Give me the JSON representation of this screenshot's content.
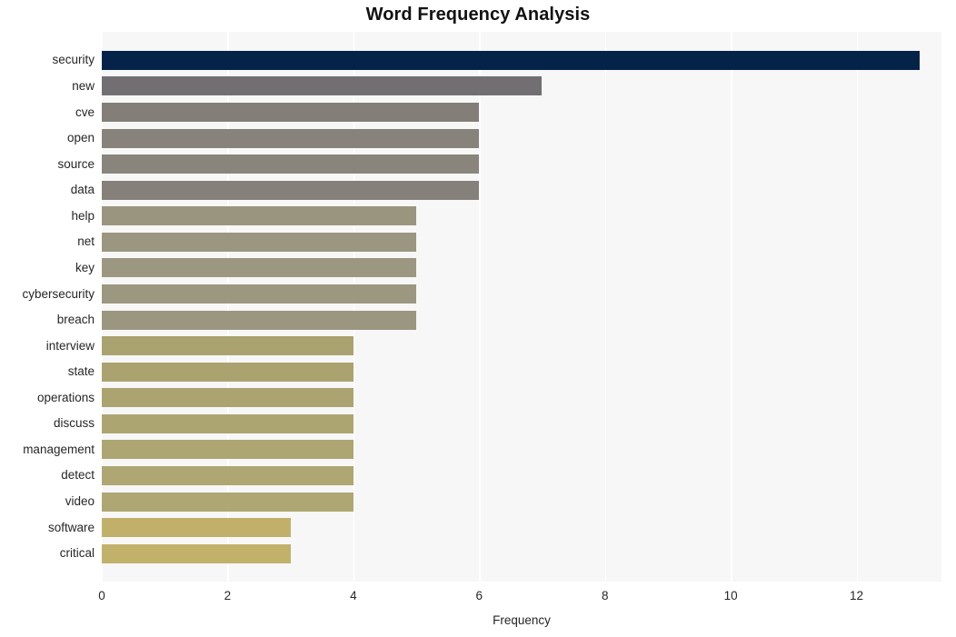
{
  "chart_data": {
    "type": "bar",
    "orientation": "horizontal",
    "title": "Word Frequency Analysis",
    "xlabel": "Frequency",
    "ylabel": "",
    "xlim": [
      0,
      13.35
    ],
    "xticks": [
      0,
      2,
      4,
      6,
      8,
      10,
      12
    ],
    "xtick_labels": [
      "0",
      "2",
      "4",
      "6",
      "8",
      "10",
      "12"
    ],
    "grid": true,
    "grid_axis": "x",
    "legend": false,
    "categories": [
      "security",
      "new",
      "cve",
      "open",
      "source",
      "data",
      "help",
      "net",
      "key",
      "cybersecurity",
      "breach",
      "interview",
      "state",
      "operations",
      "discuss",
      "management",
      "detect",
      "video",
      "software",
      "critical"
    ],
    "values": [
      13,
      7,
      6,
      6,
      6,
      6,
      5,
      5,
      5,
      5,
      5,
      4,
      4,
      4,
      4,
      4,
      4,
      4,
      3,
      3
    ],
    "bar_colors": [
      "#052349",
      "#716f71",
      "#837f78",
      "#87837b",
      "#89857c",
      "#85817a",
      "#9a957f",
      "#9b9680",
      "#9c9781",
      "#9c9781",
      "#9b9680",
      "#aaa26f",
      "#aba36f",
      "#aba370",
      "#aca471",
      "#ada572",
      "#aea673",
      "#afa773",
      "#c0b06a",
      "#c1b16b"
    ],
    "plot_background": "#f7f7f7",
    "gridline_color": "#ffffff",
    "title_color": "#121212",
    "tick_label_color": "#262626"
  }
}
